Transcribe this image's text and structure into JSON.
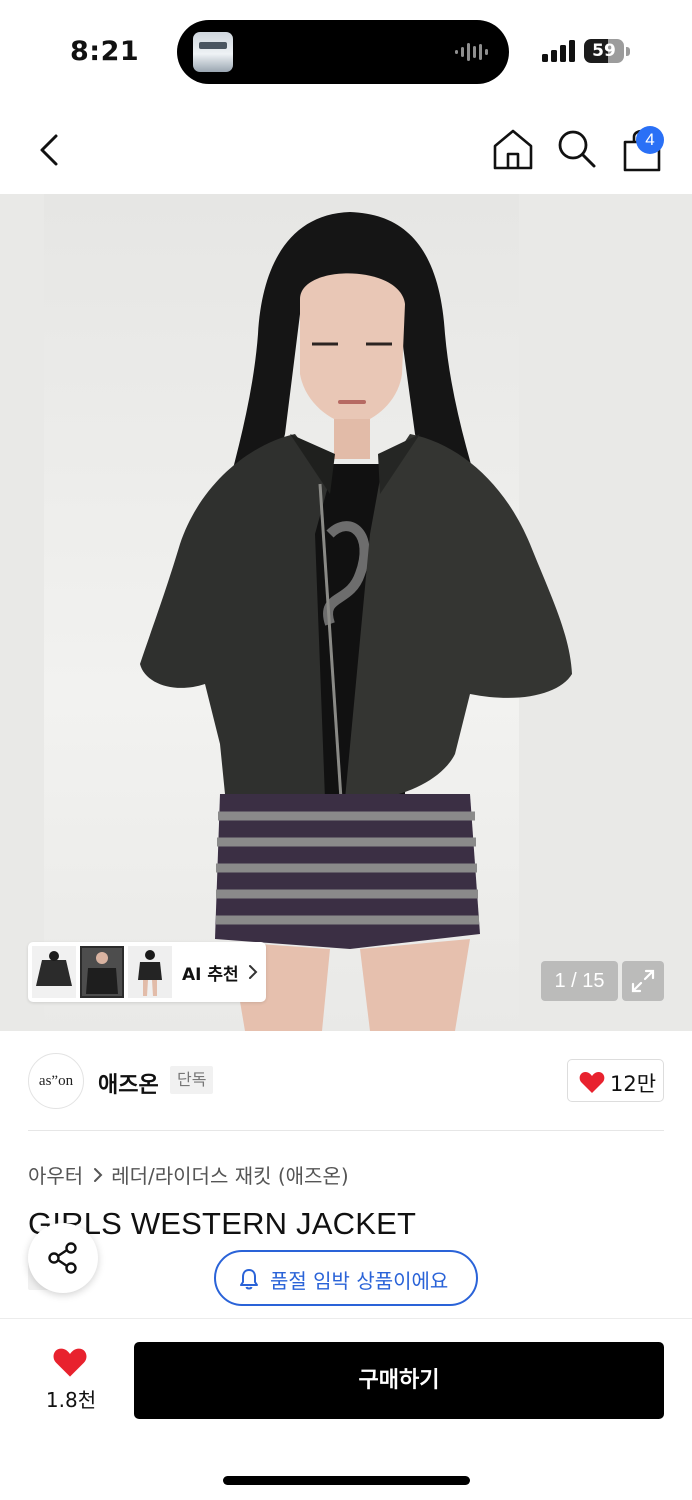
{
  "status_bar": {
    "time": "8:21",
    "battery_percent": 59,
    "battery_label": "59",
    "signal_icon": "cellular-signal-icon",
    "live_activity": "now-playing-audio-wave"
  },
  "header": {
    "back_icon": "chevron-left-icon",
    "home_icon": "home-icon",
    "search_icon": "search-icon",
    "cart_icon": "shopping-bag-icon",
    "cart_count": "4"
  },
  "gallery": {
    "ai_recommend_label": "AI 추천",
    "counter": "1 / 15",
    "expand_icon": "expand-icon",
    "thumbnail_count": 3
  },
  "brand": {
    "logo_text": "as”on",
    "name": "애즈온",
    "exclusive_tag": "단독",
    "like_count": "12만"
  },
  "product": {
    "breadcrumb": [
      "아우터",
      "레더/라이더스 재킷 (애즈온)"
    ],
    "title": "GIRLS WESTERN JACKET",
    "exclusive_tag": "단독",
    "restock_label": "품절 임박 상품이에요"
  },
  "bottom_bar": {
    "wish_count": "1.8천",
    "buy_label": "구매하기"
  },
  "colors": {
    "accent_blue": "#2a63d8",
    "badge_blue": "#2a70f6",
    "heart_red": "#e8222e",
    "buy_button": "#000000"
  }
}
